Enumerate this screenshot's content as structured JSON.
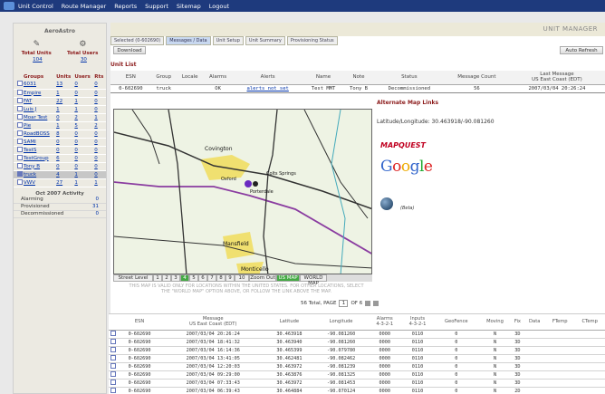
{
  "topnav": {
    "items": [
      "Unit Control",
      "Route Manager",
      "Reports",
      "Support",
      "Sitemap",
      "Logout"
    ]
  },
  "sidebar": {
    "company": "AeroAstro",
    "total_units_label": "Total Units",
    "total_users_label": "Total Users",
    "total_units": "104",
    "total_users": "30",
    "headers": {
      "groups": "Groups",
      "units": "Units",
      "users": "Users",
      "rts": "Rts"
    },
    "groups": [
      {
        "name": "6031",
        "units": "13",
        "users": "0",
        "rts": "0"
      },
      {
        "name": "Empire",
        "units": "1",
        "users": "0",
        "rts": "0"
      },
      {
        "name": "FAT",
        "units": "22",
        "users": "1",
        "rts": "0"
      },
      {
        "name": "Luis J",
        "units": "1",
        "users": "1",
        "rts": "0"
      },
      {
        "name": "Moar Test",
        "units": "0",
        "users": "2",
        "rts": "1"
      },
      {
        "name": "Pie",
        "units": "1",
        "users": "5",
        "rts": "2"
      },
      {
        "name": "RoadBOSS",
        "units": "8",
        "users": "0",
        "rts": "0"
      },
      {
        "name": "SAMI",
        "units": "0",
        "users": "0",
        "rts": "0"
      },
      {
        "name": "TestS",
        "units": "0",
        "users": "0",
        "rts": "0"
      },
      {
        "name": "TestGroup",
        "units": "6",
        "users": "0",
        "rts": "0"
      },
      {
        "name": "Tony B",
        "units": "0",
        "users": "0",
        "rts": "0"
      },
      {
        "name": "truck",
        "units": "4",
        "users": "1",
        "rts": "0"
      },
      {
        "name": "VWV",
        "units": "27",
        "users": "1",
        "rts": "1"
      }
    ],
    "activity_title": "Oct 2007 Activity",
    "activity": [
      {
        "label": "Alarming",
        "value": "0"
      },
      {
        "label": "Provisioned",
        "value": "31"
      },
      {
        "label": "Decommissioned",
        "value": "0"
      }
    ]
  },
  "main": {
    "title": "UNIT MANAGER",
    "tabs": [
      "Selected (0-602690)",
      "Messages / Data",
      "Unit Setup",
      "Unit Summary",
      "Provisioning Status"
    ],
    "download": "Download",
    "auto_refresh": "Auto Refresh",
    "unit_list_title": "Unit List",
    "unit_headers": [
      "ESN",
      "Group",
      "Locale",
      "Alarms",
      "Alerts",
      "Name",
      "Note",
      "Status",
      "Message Count",
      "Last Message\nUS East Coast (EDT)"
    ],
    "unit_row": [
      "0-602690",
      "truck",
      "",
      "OK",
      "alerts not set",
      "Test MMT",
      "Tony B",
      "Decommissioned",
      "56",
      "2007/03/04 20:26:24"
    ]
  },
  "map": {
    "places": [
      "Covington",
      "Porterdale",
      "Oxford",
      "Mansfield",
      "Monticello",
      "Colts Springs"
    ],
    "controls": [
      "Street Level",
      "1",
      "2",
      "3",
      "4",
      "5",
      "6",
      "7",
      "8",
      "9",
      "10",
      "Zoom Out",
      "US MAP",
      "WORLD MAP"
    ],
    "note": "THIS MAP IS VALID ONLY FOR LOCATIONS WITHIN THE UNITED STATES. FOR OTHER LOCATIONS, SELECT THE \"WORLD MAP\" OPTION ABOVE, OR FOLLOW THE LINK ABOVE THE MAP.",
    "pager_total": "56 Total, PAGE",
    "pager_page": "1",
    "pager_of": "OF 6"
  },
  "alt": {
    "title": "Alternate Map Links",
    "latlon": "Latitude/Longitude: 30.463918/-90.081260",
    "mapquest": "MAPQUEST",
    "beta": "(Beta)"
  },
  "messages": {
    "headers": [
      "ESN",
      "Message\nUS East Coast (EDT)",
      "Latitude",
      "Longitude",
      "Alarms\n4-3-2-1",
      "Inputs\n4-3-2-1",
      "GeoFence",
      "Moving",
      "Fix",
      "Data",
      "FTemp",
      "CTemp"
    ],
    "rows": [
      [
        "0-602690",
        "2007/03/04 20:26:24",
        "30.463918",
        "-90.081260",
        "0000",
        "0110",
        "0",
        "N",
        "3D",
        "",
        "",
        ""
      ],
      [
        "0-602690",
        "2007/03/04 18:41:32",
        "30.463940",
        "-90.081260",
        "0000",
        "0110",
        "0",
        "N",
        "3D",
        "",
        "",
        ""
      ],
      [
        "0-602690",
        "2007/03/04 16:14:36",
        "30.465399",
        "-90.079780",
        "0000",
        "0110",
        "0",
        "N",
        "3D",
        "",
        "",
        ""
      ],
      [
        "0-602690",
        "2007/03/04 13:41:05",
        "30.462481",
        "-90.082462",
        "0000",
        "0110",
        "0",
        "N",
        "3D",
        "",
        "",
        ""
      ],
      [
        "0-602690",
        "2007/03/04 12:20:03",
        "30.463972",
        "-90.081239",
        "0000",
        "0110",
        "0",
        "N",
        "3D",
        "",
        "",
        ""
      ],
      [
        "0-602690",
        "2007/03/04 09:29:00",
        "30.463876",
        "-90.081325",
        "0000",
        "0110",
        "0",
        "N",
        "3D",
        "",
        "",
        ""
      ],
      [
        "0-602690",
        "2007/03/04 07:33:43",
        "30.463972",
        "-90.081453",
        "0000",
        "0110",
        "0",
        "N",
        "3D",
        "",
        "",
        ""
      ],
      [
        "0-602690",
        "2007/03/04 06:39:43",
        "30.464884",
        "-90.070124",
        "0000",
        "0110",
        "0",
        "N",
        "2D",
        "",
        "",
        ""
      ]
    ]
  }
}
